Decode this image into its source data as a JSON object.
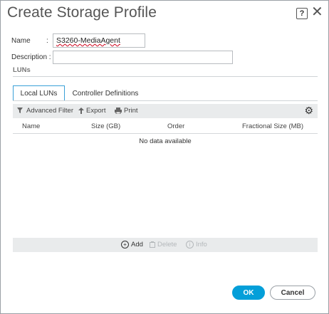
{
  "dialog": {
    "title": "Create Storage Profile",
    "help_label": "?",
    "close_label": "✕"
  },
  "form": {
    "name_label": "Name",
    "name_colon": ":",
    "name_value": "S3260-MediaAgent",
    "description_label": "Description :",
    "description_value": ""
  },
  "section": {
    "title": "LUNs"
  },
  "tabs": [
    {
      "label": "Local LUNs",
      "active": true
    },
    {
      "label": "Controller Definitions",
      "active": false
    }
  ],
  "toolbar": {
    "advanced_filter": "Advanced Filter",
    "export": "Export",
    "print": "Print"
  },
  "table": {
    "columns": [
      "Name",
      "Size (GB)",
      "Order",
      "Fractional Size (MB)"
    ],
    "empty_message": "No data available"
  },
  "footer_actions": {
    "add": "Add",
    "delete": "Delete",
    "info": "Info"
  },
  "buttons": {
    "ok": "OK",
    "cancel": "Cancel"
  },
  "colors": {
    "accent": "#049fd9",
    "tab_border": "#3aa0d8",
    "bar_bg": "#e9ebec"
  }
}
